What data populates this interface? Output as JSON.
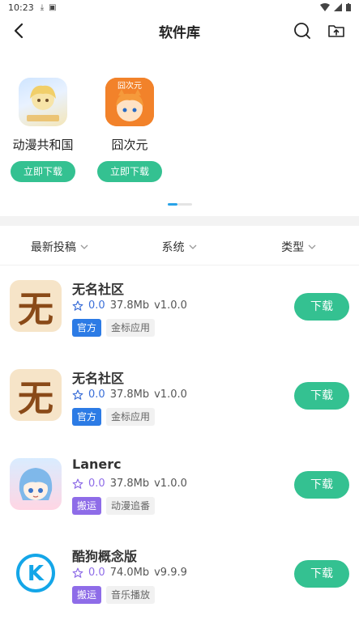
{
  "status": {
    "time": "10:23"
  },
  "appbar": {
    "title": "软件库"
  },
  "featured": [
    {
      "name": "动漫共和国",
      "button": "立即下载",
      "color_a": "#cfe5ff",
      "color_b": "#f4e6b8"
    },
    {
      "name": "囧次元",
      "button": "立即下载",
      "color_a": "#f2822a",
      "color_b": "#ffd9b0",
      "icon_text": "囧次元"
    }
  ],
  "filters": [
    {
      "label": "最新投稿"
    },
    {
      "label": "系统"
    },
    {
      "label": "类型"
    }
  ],
  "apps": [
    {
      "name": "无名社区",
      "rating": "0.0",
      "size": "37.8Mb",
      "version": "v1.0.0",
      "tag": "官方",
      "tag_type": "official",
      "category": "金标应用",
      "button": "下载",
      "icon_char": "无"
    },
    {
      "name": "无名社区",
      "rating": "0.0",
      "size": "37.8Mb",
      "version": "v1.0.0",
      "tag": "官方",
      "tag_type": "official",
      "category": "金标应用",
      "button": "下载",
      "icon_char": "无"
    },
    {
      "name": "Lanerc",
      "rating": "0.0",
      "size": "37.8Mb",
      "version": "v1.0.0",
      "tag": "搬运",
      "tag_type": "port",
      "category": "动漫追番",
      "button": "下载"
    },
    {
      "name": "酷狗概念版",
      "rating": "0.0",
      "size": "74.0Mb",
      "version": "v9.9.9",
      "tag": "搬运",
      "tag_type": "port",
      "category": "音乐播放",
      "button": "下载",
      "icon_char": "K"
    }
  ],
  "colors": {
    "accent": "#34c191",
    "official": "#2c7be5",
    "port": "#8e6ce8"
  }
}
